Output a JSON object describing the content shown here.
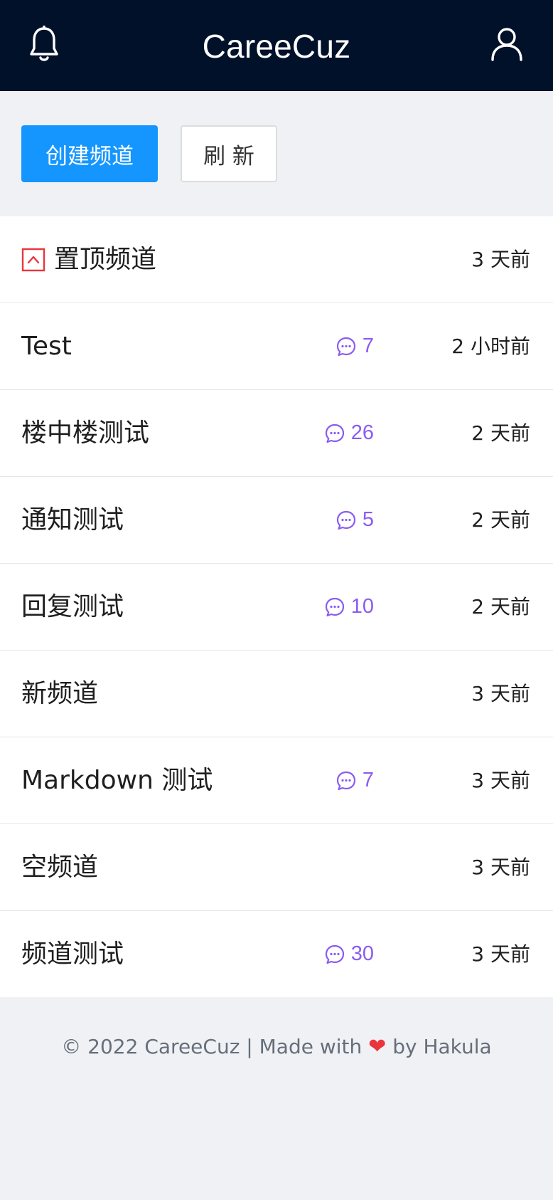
{
  "header": {
    "brand": "CareeCuz",
    "bell_icon": "bell-icon",
    "user_icon": "user-icon"
  },
  "actions": {
    "create_label": "创建频道",
    "refresh_label": "刷 新"
  },
  "channels": [
    {
      "title": "置顶频道",
      "pinned": true,
      "comments": "",
      "time": "3 天前"
    },
    {
      "title": "Test",
      "pinned": false,
      "comments": "7",
      "time": "2 小时前"
    },
    {
      "title": "楼中楼测试",
      "pinned": false,
      "comments": "26",
      "time": "2 天前"
    },
    {
      "title": "通知测试",
      "pinned": false,
      "comments": "5",
      "time": "2 天前"
    },
    {
      "title": "回复测试",
      "pinned": false,
      "comments": "10",
      "time": "2 天前"
    },
    {
      "title": "新频道",
      "pinned": false,
      "comments": "",
      "time": "3 天前"
    },
    {
      "title": "Markdown 测试",
      "pinned": false,
      "comments": "7",
      "time": "3 天前"
    },
    {
      "title": "空频道",
      "pinned": false,
      "comments": "",
      "time": "3 天前"
    },
    {
      "title": "频道测试",
      "pinned": false,
      "comments": "30",
      "time": "3 天前"
    }
  ],
  "footer": {
    "prefix": "© 2022 CareeCuz | Made with",
    "heart": "❤",
    "suffix": "by Hakula"
  },
  "colors": {
    "topbar": "#02112a",
    "primary_button": "#1596ff",
    "comment_accent": "#8a5cf0",
    "pin_accent": "#e8363c",
    "page_bg": "#eff1f5"
  }
}
